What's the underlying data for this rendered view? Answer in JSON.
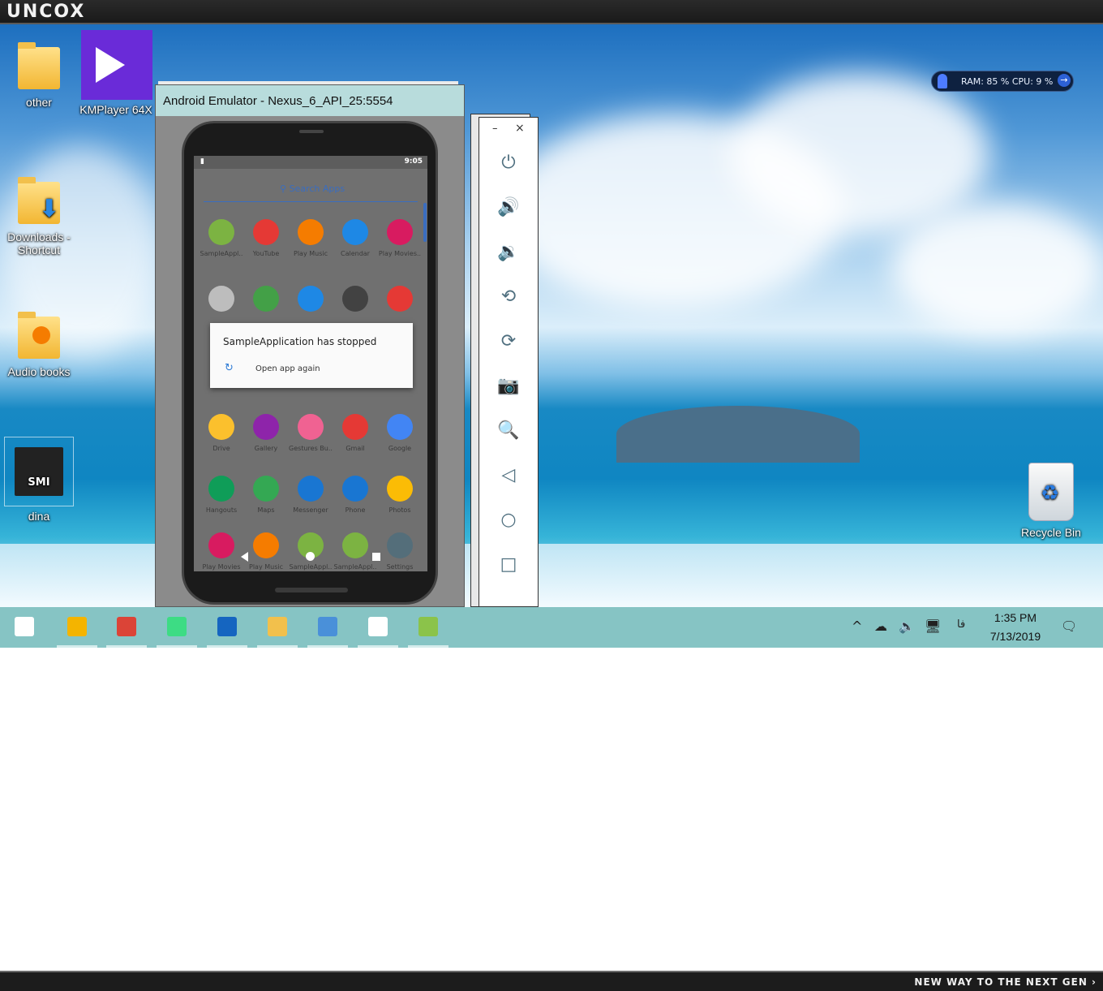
{
  "branding": {
    "logo": "UNCOX",
    "tagline": "NEW WAY TO THE NEXT GEN ›"
  },
  "desktop": {
    "icons": [
      {
        "label": "other",
        "icon": "folder-icon"
      },
      {
        "label": "KMPlayer 64X",
        "icon": "kmplayer-icon"
      },
      {
        "label": "Downloads - Shortcut",
        "icon": "downloads-folder-icon"
      },
      {
        "label": "Audio books",
        "icon": "audio-folder-icon"
      },
      {
        "label": "dina",
        "icon": "smi-icon"
      },
      {
        "label": "Recycle Bin",
        "icon": "recycle-bin-icon"
      }
    ],
    "smi_text": "SMI",
    "monitor": {
      "text": "RAM: 85 %  CPU: 9 %",
      "arrow": "→"
    }
  },
  "emulator": {
    "title": "Android Emulator - Nexus_6_API_25:5554",
    "status_time": "9:05",
    "search_placeholder": "Search Apps",
    "apps": [
      {
        "label": "SampleAppl..",
        "color": "#7cb342"
      },
      {
        "label": "YouTube",
        "color": "#e53935"
      },
      {
        "label": "Play Music",
        "color": "#f57c00"
      },
      {
        "label": "Calendar",
        "color": "#1e88e5"
      },
      {
        "label": "Play Movies..",
        "color": "#d81b60"
      },
      {
        "label": "",
        "color": "#bdbdbd"
      },
      {
        "label": "",
        "color": "#43a047"
      },
      {
        "label": "",
        "color": "#1e88e5"
      },
      {
        "label": "",
        "color": "#424242"
      },
      {
        "label": "",
        "color": "#e53935"
      },
      {
        "label": "Drive",
        "color": "#fbc02d"
      },
      {
        "label": "Gallery",
        "color": "#8e24aa"
      },
      {
        "label": "Gestures Bu..",
        "color": "#f06292"
      },
      {
        "label": "Gmail",
        "color": "#e53935"
      },
      {
        "label": "Google",
        "color": "#4285f4"
      },
      {
        "label": "Hangouts",
        "color": "#0f9d58"
      },
      {
        "label": "Maps",
        "color": "#34a853"
      },
      {
        "label": "Messenger",
        "color": "#1976d2"
      },
      {
        "label": "Phone",
        "color": "#1976d2"
      },
      {
        "label": "Photos",
        "color": "#fbbc05"
      },
      {
        "label": "Play Movies",
        "color": "#d81b60"
      },
      {
        "label": "Play Music",
        "color": "#f57c00"
      },
      {
        "label": "SampleAppl..",
        "color": "#7cb342"
      },
      {
        "label": "SampleAppl..",
        "color": "#7cb342"
      },
      {
        "label": "Settings",
        "color": "#546e7a"
      }
    ],
    "dialog": {
      "title": "SampleApplication has stopped",
      "action": "Open app again"
    }
  },
  "toolbar": {
    "minimize": "–",
    "close": "×",
    "buttons": [
      {
        "name": "power-icon",
        "glyph": "⏻"
      },
      {
        "name": "volume-up-icon",
        "glyph": "🔊"
      },
      {
        "name": "volume-down-icon",
        "glyph": "🔉"
      },
      {
        "name": "rotate-left-icon",
        "glyph": "⟲"
      },
      {
        "name": "rotate-right-icon",
        "glyph": "⟳"
      },
      {
        "name": "camera-icon",
        "glyph": "📷"
      },
      {
        "name": "zoom-icon",
        "glyph": "🔍"
      },
      {
        "name": "back-icon",
        "glyph": "◁"
      },
      {
        "name": "home-icon",
        "glyph": "○"
      },
      {
        "name": "overview-icon",
        "glyph": "□"
      }
    ]
  },
  "taskbar": {
    "time": "1:35 PM",
    "date": "7/13/2019",
    "language": "فا",
    "apps": [
      {
        "name": "start-button",
        "color": "#ffffff"
      },
      {
        "name": "taskbar-tips-icon",
        "color": "#f4b400"
      },
      {
        "name": "taskbar-chrome-icon",
        "color": "#db4437"
      },
      {
        "name": "taskbar-android-studio-icon",
        "color": "#3ddc84"
      },
      {
        "name": "taskbar-layout-icon",
        "color": "#1565c0"
      },
      {
        "name": "taskbar-file-explorer-icon",
        "color": "#f2c04c"
      },
      {
        "name": "taskbar-control-panel-icon",
        "color": "#4a90d9"
      },
      {
        "name": "taskbar-clapper-icon",
        "color": "#ffffff"
      },
      {
        "name": "taskbar-emulator-icon",
        "color": "#8bc34a"
      }
    ]
  }
}
